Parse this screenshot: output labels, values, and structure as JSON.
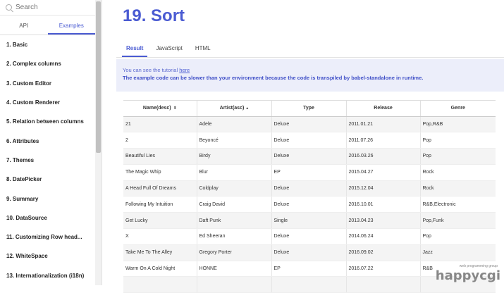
{
  "sidebar": {
    "search_placeholder": "Search",
    "tabs": [
      {
        "label": "API"
      },
      {
        "label": "Examples"
      }
    ],
    "items": [
      {
        "label": "1. Basic"
      },
      {
        "label": "2. Complex columns"
      },
      {
        "label": "3. Custom Editor"
      },
      {
        "label": "4. Custom Renderer"
      },
      {
        "label": "5. Relation between columns"
      },
      {
        "label": "6. Attributes"
      },
      {
        "label": "7. Themes"
      },
      {
        "label": "8. DatePicker"
      },
      {
        "label": "9. Summary"
      },
      {
        "label": "10. DataSource"
      },
      {
        "label": "11. Customizing Row head..."
      },
      {
        "label": "12. WhiteSpace"
      },
      {
        "label": "13. Internationalization (i18n)"
      }
    ]
  },
  "main": {
    "title": "19. Sort",
    "tabs": [
      {
        "label": "Result"
      },
      {
        "label": "JavaScript"
      },
      {
        "label": "HTML"
      }
    ],
    "notice": {
      "text": "You can see the tutorial ",
      "link": "here",
      "warning": "The example code can be slower than your environment because the code is transpiled by babel-standalone in runtime."
    }
  },
  "grid": {
    "columns": [
      {
        "label": "Name(desc)",
        "sort": "⬍"
      },
      {
        "label": "Artist(asc)",
        "sort": "▴"
      },
      {
        "label": "Type",
        "sort": ""
      },
      {
        "label": "Release",
        "sort": ""
      },
      {
        "label": "Genre",
        "sort": ""
      }
    ],
    "rows": [
      [
        "21",
        "Adele",
        "Deluxe",
        "2011.01.21",
        "Pop,R&B"
      ],
      [
        "2",
        "Beyoncé",
        "Deluxe",
        "2011.07.26",
        "Pop"
      ],
      [
        "Beautiful Lies",
        "Birdy",
        "Deluxe",
        "2016.03.26",
        "Pop"
      ],
      [
        "The Magic Whip",
        "Blur",
        "EP",
        "2015.04.27",
        "Rock"
      ],
      [
        "A Head Full Of Dreams",
        "Coldplay",
        "Deluxe",
        "2015.12.04",
        "Rock"
      ],
      [
        "Following My Intuition",
        "Craig David",
        "Deluxe",
        "2016.10.01",
        "R&B,Electronic"
      ],
      [
        "Get Lucky",
        "Daft Punk",
        "Single",
        "2013.04.23",
        "Pop,Funk"
      ],
      [
        "X",
        "Ed Sheeran",
        "Deluxe",
        "2014.06.24",
        "Pop"
      ],
      [
        "Take Me To The Alley",
        "Gregory Porter",
        "Deluxe",
        "2016.09.02",
        "Jazz"
      ],
      [
        "Warm On A Cold Night",
        "HONNE",
        "EP",
        "2016.07.22",
        "R&B"
      ],
      [
        "",
        "",
        "",
        "",
        ""
      ]
    ]
  },
  "watermark": {
    "small": "web programming group",
    "big": "happycgi"
  }
}
